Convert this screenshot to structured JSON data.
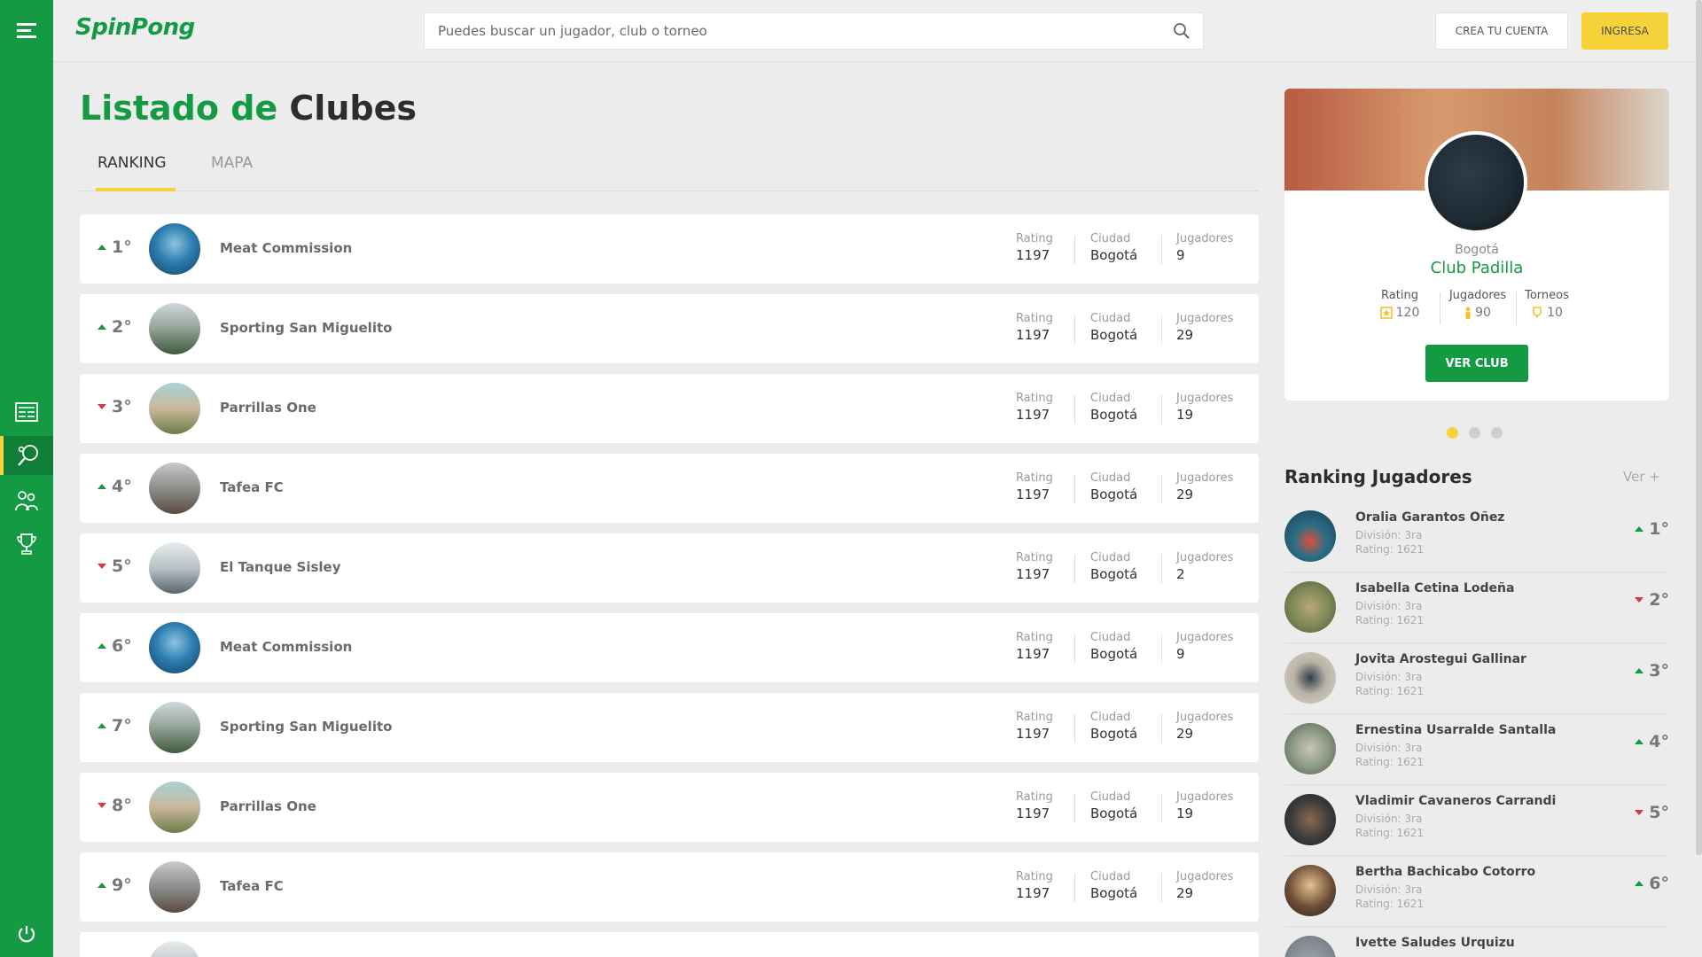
{
  "app": {
    "logo": "SpinPong"
  },
  "search": {
    "placeholder": "Puedes buscar un jugador, club o torneo"
  },
  "header": {
    "create_account": "CREA TU CUENTA",
    "login": "INGRESA"
  },
  "page": {
    "title_part1": "Listado de",
    "title_part2": "Clubes"
  },
  "tabs": [
    {
      "label": "RANKING",
      "active": true
    },
    {
      "label": "MAPA",
      "active": false
    }
  ],
  "labels": {
    "rating": "Rating",
    "ciudad": "Ciudad",
    "jugadores": "Jugadores"
  },
  "clubs": [
    {
      "rank": "1°",
      "trend": "up",
      "name": "Meat Commission",
      "rating": "1197",
      "city": "Bogotá",
      "players": "9"
    },
    {
      "rank": "2°",
      "trend": "up",
      "name": "Sporting San Miguelito",
      "rating": "1197",
      "city": "Bogotá",
      "players": "29"
    },
    {
      "rank": "3°",
      "trend": "down",
      "name": "Parrillas One",
      "rating": "1197",
      "city": "Bogotá",
      "players": "19"
    },
    {
      "rank": "4°",
      "trend": "up",
      "name": "Tafea FC",
      "rating": "1197",
      "city": "Bogotá",
      "players": "29"
    },
    {
      "rank": "5°",
      "trend": "down",
      "name": "El Tanque Sisley",
      "rating": "1197",
      "city": "Bogotá",
      "players": "2"
    },
    {
      "rank": "6°",
      "trend": "up",
      "name": "Meat Commission",
      "rating": "1197",
      "city": "Bogotá",
      "players": "9"
    },
    {
      "rank": "7°",
      "trend": "up",
      "name": "Sporting San Miguelito",
      "rating": "1197",
      "city": "Bogotá",
      "players": "29"
    },
    {
      "rank": "8°",
      "trend": "down",
      "name": "Parrillas One",
      "rating": "1197",
      "city": "Bogotá",
      "players": "19"
    },
    {
      "rank": "9°",
      "trend": "up",
      "name": "Tafea FC",
      "rating": "1197",
      "city": "Bogotá",
      "players": "29"
    }
  ],
  "featured": {
    "city": "Bogotá",
    "name": "Club Padilla",
    "rating_label": "Rating",
    "rating": "120",
    "players_label": "Jugadores",
    "players": "90",
    "tournaments_label": "Torneos",
    "tournaments": "10",
    "button": "VER CLUB"
  },
  "ranking": {
    "title": "Ranking Jugadores",
    "more": "Ver +",
    "players": [
      {
        "name": "Oralia Garantos Oñez",
        "division": "División: 3ra",
        "rating": "Rating: 1621",
        "rank": "1°",
        "trend": "up"
      },
      {
        "name": "Isabella Cetina Lodeña",
        "division": "División: 3ra",
        "rating": "Rating: 1621",
        "rank": "2°",
        "trend": "down"
      },
      {
        "name": "Jovita Arostegui Gallinar",
        "division": "División: 3ra",
        "rating": "Rating: 1621",
        "rank": "3°",
        "trend": "up"
      },
      {
        "name": "Ernestina Usarralde Santalla",
        "division": "División: 3ra",
        "rating": "Rating: 1621",
        "rank": "4°",
        "trend": "up"
      },
      {
        "name": "Vladimir Cavaneros Carrandi",
        "division": "División: 3ra",
        "rating": "Rating: 1621",
        "rank": "5°",
        "trend": "down"
      },
      {
        "name": "Bertha Bachicabo Cotorro",
        "division": "División: 3ra",
        "rating": "Rating: 1621",
        "rank": "6°",
        "trend": "up"
      },
      {
        "name": "Ivette Saludes Urquizu",
        "division": "",
        "rating": "",
        "rank": "",
        "trend": ""
      }
    ]
  },
  "colors": {
    "brand_green": "#139a43",
    "accent_yellow": "#f6d33a",
    "trend_down": "#e0334a"
  },
  "icons": [
    "menu-icon",
    "search-icon",
    "list-icon",
    "ping-pong-icon",
    "players-icon",
    "trophy-icon",
    "power-icon",
    "star-icon",
    "person-icon"
  ]
}
